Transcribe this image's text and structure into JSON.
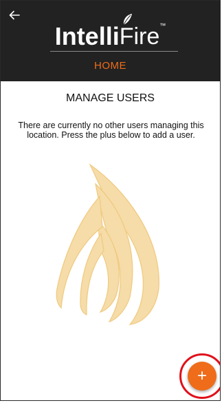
{
  "header": {
    "back_icon": "arrow-left-icon",
    "logo": {
      "part_bold": "Intelli",
      "part_light": "Fire",
      "trademark": "™"
    },
    "nav_label": "HOME"
  },
  "main": {
    "title": "MANAGE USERS",
    "message": "There are currently no other users managing this location. Press the plus below to add a user."
  },
  "fab": {
    "label": "+",
    "icon": "plus-icon"
  },
  "colors": {
    "header_bg": "#222222",
    "accent": "#ef6c1a",
    "highlight_ring": "#e0101a",
    "watermark_flame": "#f5dca8"
  }
}
